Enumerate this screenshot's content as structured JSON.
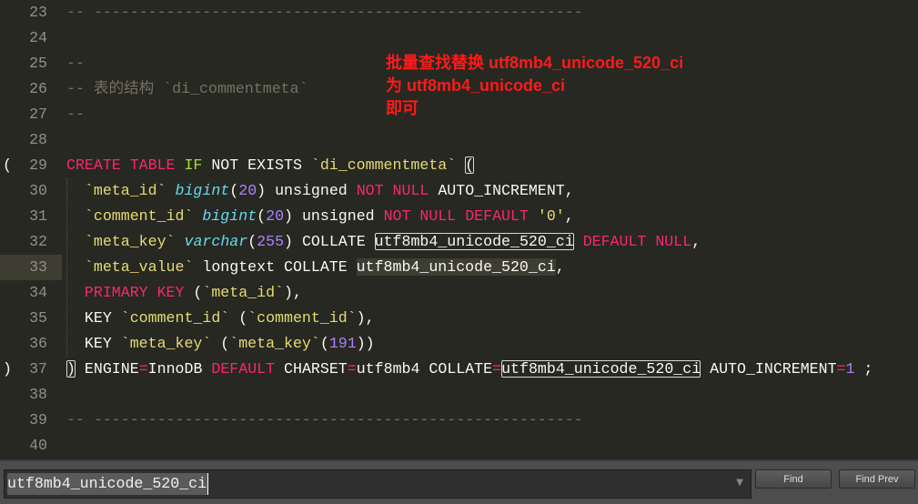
{
  "annotation": [
    "批量查找替换 utf8mb4_unicode_520_ci",
    "为 utf8mb4_unicode_ci",
    "即可"
  ],
  "fold_markers": {
    "29": "(",
    "37": ")"
  },
  "current_line": 33,
  "lines": [
    {
      "num": "23",
      "tokens": [
        {
          "t": "-- ------------------------------------------------------",
          "c": "c"
        }
      ]
    },
    {
      "num": "24",
      "tokens": []
    },
    {
      "num": "25",
      "tokens": [
        {
          "t": "--",
          "c": "c"
        }
      ]
    },
    {
      "num": "26",
      "tokens": [
        {
          "t": "-- 表的结构 `di_commentmeta`",
          "c": "c"
        }
      ]
    },
    {
      "num": "27",
      "tokens": [
        {
          "t": "--",
          "c": "c"
        }
      ]
    },
    {
      "num": "28",
      "tokens": []
    },
    {
      "num": "29",
      "tokens": [
        {
          "t": "CREATE TABLE ",
          "c": "k"
        },
        {
          "t": "IF",
          "c": "g"
        },
        {
          "t": " NOT EXISTS ",
          "c": "w"
        },
        {
          "t": "`di_commentmeta`",
          "c": "s"
        },
        {
          "t": " ",
          "c": "w"
        },
        {
          "t": "(",
          "c": "w box"
        }
      ]
    },
    {
      "num": "30",
      "tokens": [
        {
          "t": "  ",
          "c": "w"
        },
        {
          "t": "`meta_id`",
          "c": "s"
        },
        {
          "t": " ",
          "c": "w"
        },
        {
          "t": "bigint",
          "c": "t"
        },
        {
          "t": "(",
          "c": "w"
        },
        {
          "t": "20",
          "c": "n"
        },
        {
          "t": ") unsigned ",
          "c": "w"
        },
        {
          "t": "NOT NULL",
          "c": "k"
        },
        {
          "t": " AUTO_INCREMENT,",
          "c": "w"
        }
      ]
    },
    {
      "num": "31",
      "tokens": [
        {
          "t": "  ",
          "c": "w"
        },
        {
          "t": "`comment_id`",
          "c": "s"
        },
        {
          "t": " ",
          "c": "w"
        },
        {
          "t": "bigint",
          "c": "t"
        },
        {
          "t": "(",
          "c": "w"
        },
        {
          "t": "20",
          "c": "n"
        },
        {
          "t": ") unsigned ",
          "c": "w"
        },
        {
          "t": "NOT NULL DEFAULT",
          "c": "k"
        },
        {
          "t": " ",
          "c": "w"
        },
        {
          "t": "'0'",
          "c": "s"
        },
        {
          "t": ",",
          "c": "w"
        }
      ]
    },
    {
      "num": "32",
      "tokens": [
        {
          "t": "  ",
          "c": "w"
        },
        {
          "t": "`meta_key`",
          "c": "s"
        },
        {
          "t": " ",
          "c": "w"
        },
        {
          "t": "varchar",
          "c": "t"
        },
        {
          "t": "(",
          "c": "w"
        },
        {
          "t": "255",
          "c": "n"
        },
        {
          "t": ") COLLATE ",
          "c": "w"
        },
        {
          "t": "utf8mb4_unicode_520_ci",
          "c": "w box"
        },
        {
          "t": " ",
          "c": "w"
        },
        {
          "t": "DEFAULT NULL",
          "c": "k"
        },
        {
          "t": ",",
          "c": "w"
        }
      ]
    },
    {
      "num": "33",
      "tokens": [
        {
          "t": "  ",
          "c": "w"
        },
        {
          "t": "`meta_value`",
          "c": "s"
        },
        {
          "t": " longtext COLLATE ",
          "c": "w"
        },
        {
          "t": "utf8mb4_unicode_520_ci",
          "c": "w hl"
        },
        {
          "t": ",",
          "c": "w"
        }
      ]
    },
    {
      "num": "34",
      "tokens": [
        {
          "t": "  ",
          "c": "w"
        },
        {
          "t": "PRIMARY KEY",
          "c": "k"
        },
        {
          "t": " (",
          "c": "w"
        },
        {
          "t": "`meta_id`",
          "c": "s"
        },
        {
          "t": "),",
          "c": "w"
        }
      ]
    },
    {
      "num": "35",
      "tokens": [
        {
          "t": "  KEY ",
          "c": "w"
        },
        {
          "t": "`comment_id`",
          "c": "s"
        },
        {
          "t": " (",
          "c": "w"
        },
        {
          "t": "`comment_id`",
          "c": "s"
        },
        {
          "t": "),",
          "c": "w"
        }
      ]
    },
    {
      "num": "36",
      "tokens": [
        {
          "t": "  KEY ",
          "c": "w"
        },
        {
          "t": "`meta_key`",
          "c": "s"
        },
        {
          "t": " (",
          "c": "w"
        },
        {
          "t": "`meta_key`",
          "c": "s"
        },
        {
          "t": "(",
          "c": "w"
        },
        {
          "t": "191",
          "c": "n"
        },
        {
          "t": "))",
          "c": "w"
        }
      ]
    },
    {
      "num": "37",
      "tokens": [
        {
          "t": ")",
          "c": "w box"
        },
        {
          "t": " ENGINE",
          "c": "w"
        },
        {
          "t": "=",
          "c": "k"
        },
        {
          "t": "InnoDB ",
          "c": "w"
        },
        {
          "t": "DEFAULT",
          "c": "k"
        },
        {
          "t": " CHARSET",
          "c": "w"
        },
        {
          "t": "=",
          "c": "k"
        },
        {
          "t": "utf8mb4 COLLATE",
          "c": "w"
        },
        {
          "t": "=",
          "c": "k"
        },
        {
          "t": "utf8mb4_unicode_520_ci",
          "c": "w box"
        },
        {
          "t": " AUTO_INCREMENT",
          "c": "w"
        },
        {
          "t": "=",
          "c": "k"
        },
        {
          "t": "1",
          "c": "n"
        },
        {
          "t": " ;",
          "c": "w"
        }
      ]
    },
    {
      "num": "38",
      "tokens": []
    },
    {
      "num": "39",
      "tokens": [
        {
          "t": "-- ------------------------------------------------------",
          "c": "c"
        }
      ]
    },
    {
      "num": "40",
      "tokens": []
    }
  ],
  "find": {
    "value": "utf8mb4_unicode_520_ci",
    "dropdown_icon": "chevron-down-icon",
    "find_label": "Find",
    "find_prev_label": "Find Prev"
  }
}
